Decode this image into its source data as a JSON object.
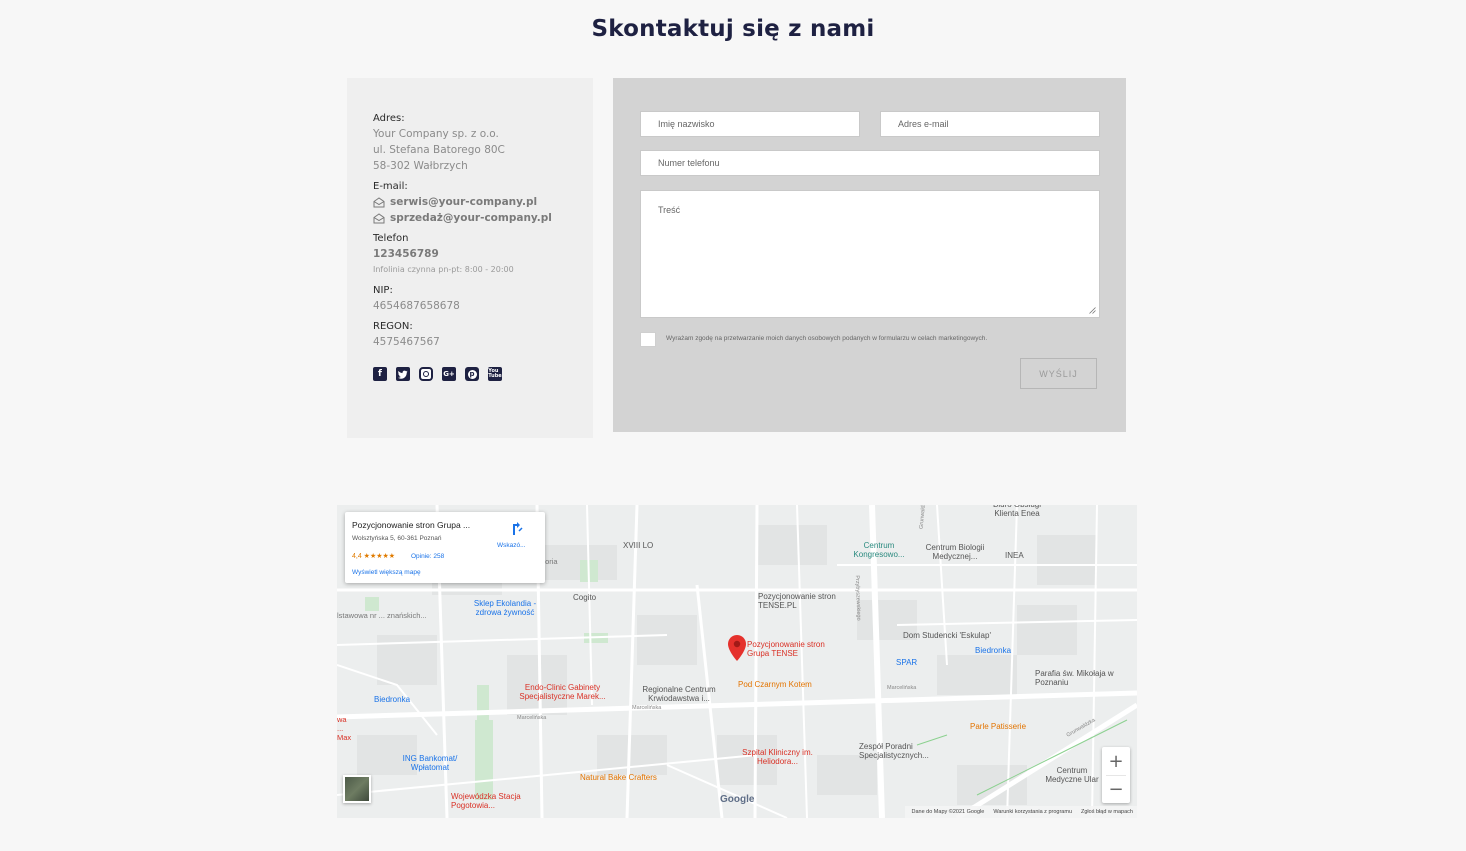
{
  "page": {
    "title": "Skontaktuj się z nami"
  },
  "contact": {
    "address_label": "Adres:",
    "address_lines": [
      "Your Company sp. z o.o.",
      "ul. Stefana Batorego 80C",
      "58-302 Wałbrzych"
    ],
    "email_label": "E-mail:",
    "emails": [
      "serwis@your-company.pl",
      "sprzedaż@your-company.pl"
    ],
    "phone_label": "Telefon",
    "phone": "123456789",
    "hotline": "Infolinia czynna pn-pt: 8:00 - 20:00",
    "nip_label": "NIP:",
    "nip": "4654687658678",
    "regon_label": "REGON:",
    "regon": "4575467567",
    "social": [
      "facebook-icon",
      "twitter-icon",
      "instagram-icon",
      "google-plus-icon",
      "pinterest-icon",
      "youtube-icon"
    ]
  },
  "form": {
    "name_placeholder": "Imię nazwisko",
    "email_placeholder": "Adres e-mail",
    "phone_placeholder": "Numer telefonu",
    "message_placeholder": "Treść",
    "consent": "Wyrażam zgodę na przetwarzanie moich danych osobowych podanych w formularzu w celach marketingowych.",
    "submit": "WYŚLIJ"
  },
  "map": {
    "card": {
      "name": "Pozycjonowanie stron Grupa ...",
      "address": "Wolsztyńska 5, 60-361 Poznań",
      "rating": "4,4 ★★★★★",
      "reviews": "Opinie: 258",
      "larger_map": "Wyświetl większą mapę",
      "directions": "Wskazó..."
    },
    "places": {
      "p1": "Biuro Obsługi Klienta Enea",
      "p2": "XVIII LO",
      "p3": "Centrum Kongresowo...",
      "p4": "Centrum Biologii Medycznej...",
      "p5": "INEA",
      "p6": "Pozycjonowanie stron TENSE.PL",
      "p7": "Cogito",
      "p8": "Sklep Ekolandia - zdrowa żywność",
      "p9": "Pozycjonowanie stron Grupa TENSE",
      "p10": "Dom Studencki 'Eskulap'",
      "p11": "Biedronka",
      "p12": "SPAR",
      "p13": "Parafia św. Mikołaja w Poznaniu",
      "p14": "Endo-Clinic Gabinety Specjalistyczne Marek...",
      "p15": "Regionalne Centrum Krwiodawstwa i...",
      "p16": "Pod Czarnym Kotem",
      "p17": "Biedronka",
      "p18": "Parle Patisserie",
      "p19": "Szpital Kliniczny im. Heliodora...",
      "p20": "Zespół Poradni Specjalistycznych...",
      "p21": "ING Bankomat/ Wpłatomat",
      "p22": "Natural Bake Crafters",
      "p23": "Centrum Medyczne Ular",
      "p24": "Wojewódzka Stacja Pogotowia...",
      "p25": "Marcelińska",
      "p26": "Marcelińska",
      "p27": "Przybyszewskiego",
      "p28": "Grunwaldzka",
      "p29": "Marcelińska",
      "p30": "lstawowa nr ... znańskich...",
      "p31": "toria",
      "p32": "wa ... Max"
    },
    "zoom_in": "+",
    "zoom_out": "−",
    "google": "Google",
    "attribution": [
      "Dane do Mapy ©2021 Google",
      "Warunki korzystania z programu",
      "Zgłoś błąd w mapach"
    ]
  }
}
